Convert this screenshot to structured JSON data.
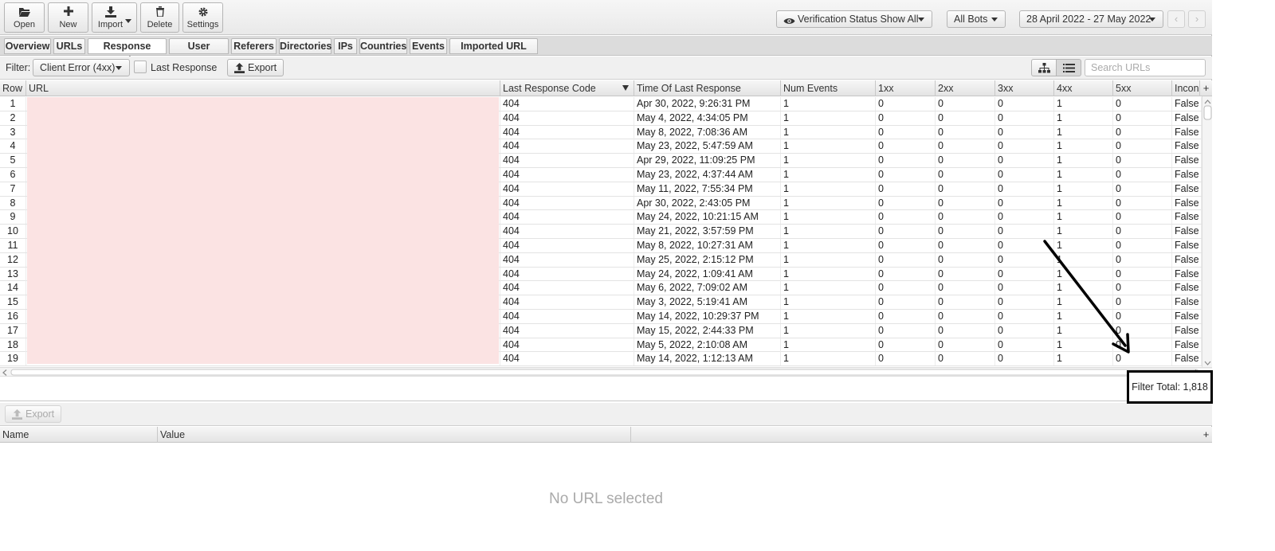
{
  "toolbar": {
    "open_label": "Open",
    "new_label": "New",
    "import_label": "Import",
    "delete_label": "Delete",
    "settings_label": "Settings",
    "verification_label": "Verification Status Show All",
    "bots_label": "All Bots",
    "date_range": "28 April 2022 - 27 May 2022",
    "prev_glyph": "‹",
    "next_glyph": "›"
  },
  "tabs": [
    "Overview",
    "URLs",
    "Response Codes",
    "User Agents",
    "Referers",
    "Directories",
    "IPs",
    "Countries",
    "Events",
    "Imported URL Data"
  ],
  "filterbar": {
    "label": "Filter:",
    "filter_value": "Client Error (4xx)",
    "last_response_label": "Last Response",
    "export_label": "Export",
    "search_placeholder": "Search URLs"
  },
  "grid": {
    "columns": [
      "Row",
      "URL",
      "Last Response Code",
      "Time Of Last Response",
      "Num Events",
      "1xx",
      "2xx",
      "3xx",
      "4xx",
      "5xx",
      "Inconsistent"
    ],
    "rows": [
      {
        "row": "1",
        "code": "404",
        "time": "Apr 30, 2022, 9:26:31 PM",
        "events": "1",
        "c1": "0",
        "c2": "0",
        "c3": "0",
        "c4": "1",
        "c5": "0",
        "inc": "False"
      },
      {
        "row": "2",
        "code": "404",
        "time": "May 4, 2022, 4:34:05 PM",
        "events": "1",
        "c1": "0",
        "c2": "0",
        "c3": "0",
        "c4": "1",
        "c5": "0",
        "inc": "False"
      },
      {
        "row": "3",
        "code": "404",
        "time": "May 8, 2022, 7:08:36 AM",
        "events": "1",
        "c1": "0",
        "c2": "0",
        "c3": "0",
        "c4": "1",
        "c5": "0",
        "inc": "False"
      },
      {
        "row": "4",
        "code": "404",
        "time": "May 23, 2022, 5:47:59 AM",
        "events": "1",
        "c1": "0",
        "c2": "0",
        "c3": "0",
        "c4": "1",
        "c5": "0",
        "inc": "False"
      },
      {
        "row": "5",
        "code": "404",
        "time": "Apr 29, 2022, 11:09:25 PM",
        "events": "1",
        "c1": "0",
        "c2": "0",
        "c3": "0",
        "c4": "1",
        "c5": "0",
        "inc": "False"
      },
      {
        "row": "6",
        "code": "404",
        "time": "May 23, 2022, 4:37:44 AM",
        "events": "1",
        "c1": "0",
        "c2": "0",
        "c3": "0",
        "c4": "1",
        "c5": "0",
        "inc": "False"
      },
      {
        "row": "7",
        "code": "404",
        "time": "May 11, 2022, 7:55:34 PM",
        "events": "1",
        "c1": "0",
        "c2": "0",
        "c3": "0",
        "c4": "1",
        "c5": "0",
        "inc": "False"
      },
      {
        "row": "8",
        "code": "404",
        "time": "Apr 30, 2022, 2:43:05 PM",
        "events": "1",
        "c1": "0",
        "c2": "0",
        "c3": "0",
        "c4": "1",
        "c5": "0",
        "inc": "False"
      },
      {
        "row": "9",
        "code": "404",
        "time": "May 24, 2022, 10:21:15 AM",
        "events": "1",
        "c1": "0",
        "c2": "0",
        "c3": "0",
        "c4": "1",
        "c5": "0",
        "inc": "False"
      },
      {
        "row": "10",
        "code": "404",
        "time": "May 21, 2022, 3:57:59 PM",
        "events": "1",
        "c1": "0",
        "c2": "0",
        "c3": "0",
        "c4": "1",
        "c5": "0",
        "inc": "False"
      },
      {
        "row": "11",
        "code": "404",
        "time": "May 8, 2022, 10:27:31 AM",
        "events": "1",
        "c1": "0",
        "c2": "0",
        "c3": "0",
        "c4": "1",
        "c5": "0",
        "inc": "False"
      },
      {
        "row": "12",
        "code": "404",
        "time": "May 25, 2022, 2:15:12 PM",
        "events": "1",
        "c1": "0",
        "c2": "0",
        "c3": "0",
        "c4": "1",
        "c5": "0",
        "inc": "False"
      },
      {
        "row": "13",
        "code": "404",
        "time": "May 24, 2022, 1:09:41 AM",
        "events": "1",
        "c1": "0",
        "c2": "0",
        "c3": "0",
        "c4": "1",
        "c5": "0",
        "inc": "False"
      },
      {
        "row": "14",
        "code": "404",
        "time": "May 6, 2022, 7:09:02 AM",
        "events": "1",
        "c1": "0",
        "c2": "0",
        "c3": "0",
        "c4": "1",
        "c5": "0",
        "inc": "False"
      },
      {
        "row": "15",
        "code": "404",
        "time": "May 3, 2022, 5:19:41 AM",
        "events": "1",
        "c1": "0",
        "c2": "0",
        "c3": "0",
        "c4": "1",
        "c5": "0",
        "inc": "False"
      },
      {
        "row": "16",
        "code": "404",
        "time": "May 14, 2022, 10:29:37 PM",
        "events": "1",
        "c1": "0",
        "c2": "0",
        "c3": "0",
        "c4": "1",
        "c5": "0",
        "inc": "False"
      },
      {
        "row": "17",
        "code": "404",
        "time": "May 15, 2022, 2:44:33 PM",
        "events": "1",
        "c1": "0",
        "c2": "0",
        "c3": "0",
        "c4": "1",
        "c5": "0",
        "inc": "False"
      },
      {
        "row": "18",
        "code": "404",
        "time": "May 5, 2022, 2:10:08 AM",
        "events": "1",
        "c1": "0",
        "c2": "0",
        "c3": "0",
        "c4": "1",
        "c5": "0",
        "inc": "False"
      },
      {
        "row": "19",
        "code": "404",
        "time": "May 14, 2022, 1:12:13 AM",
        "events": "1",
        "c1": "0",
        "c2": "0",
        "c3": "0",
        "c4": "1",
        "c5": "0",
        "inc": "False"
      }
    ]
  },
  "status": {
    "filter_total": "Filter Total: 1,818"
  },
  "lower": {
    "export_label": "Export",
    "columns": [
      "Name",
      "Value"
    ],
    "empty_text": "No URL selected"
  },
  "colors": {
    "redacted_url": "#fbe3e3",
    "annotation": "#000000"
  }
}
